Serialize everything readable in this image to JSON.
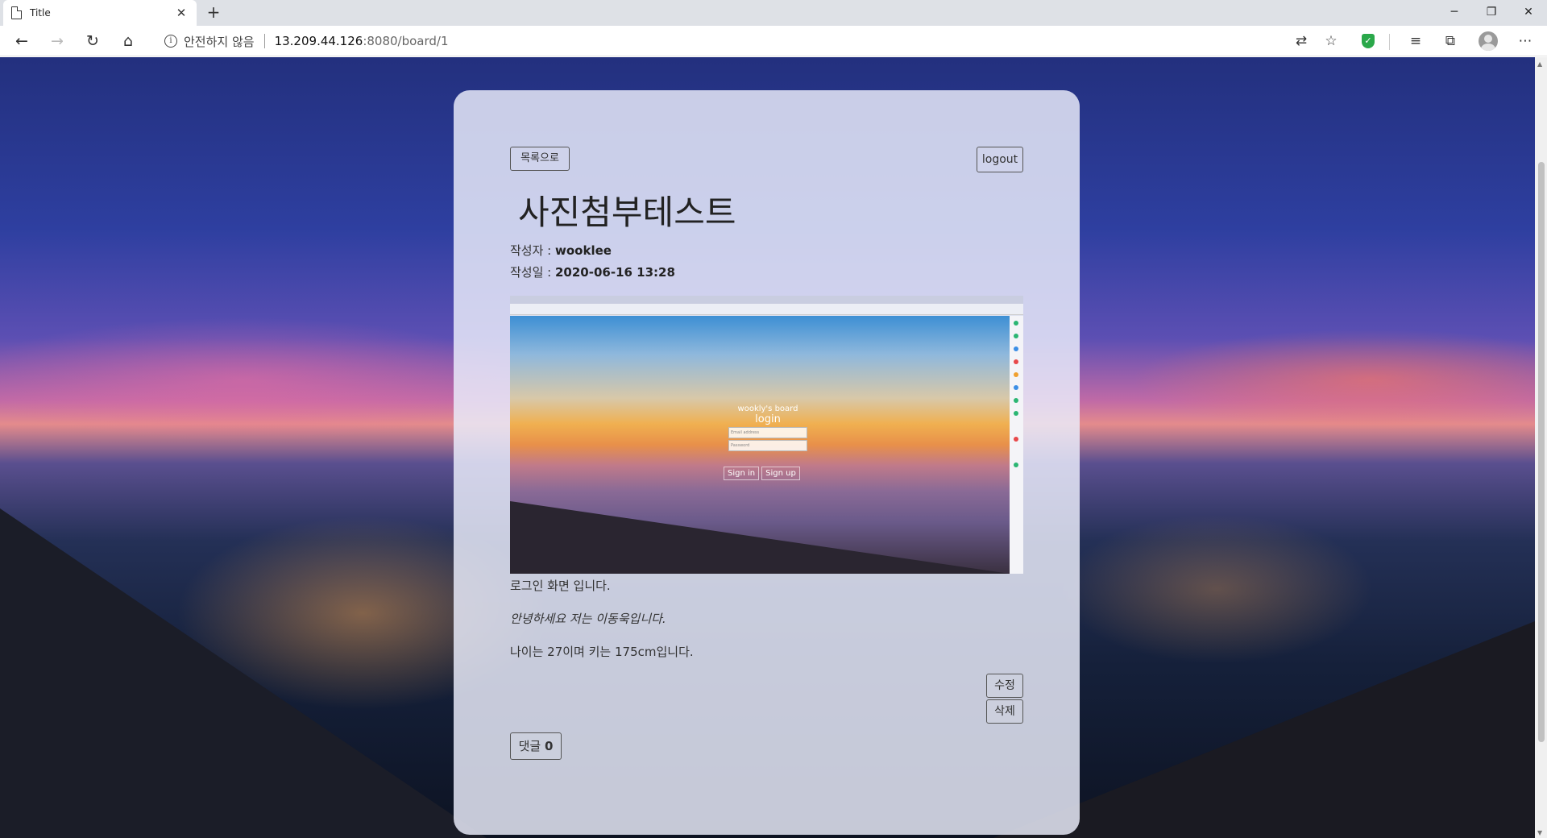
{
  "browser": {
    "tab_title": "Title",
    "address_insecure": "안전하지 않음",
    "address_host": "13.209.44.126",
    "address_rest": ":8080/board/1"
  },
  "page": {
    "back_label": "목록으로",
    "logout_label": "logout",
    "title": "사진첨부테스트",
    "author_label": "작성자 : ",
    "author": "wooklee",
    "date_label": "작성일 : ",
    "date": "2020-06-16 13:28",
    "content_lines": [
      "로그인 화면 입니다.",
      "안녕하세요 저는 이동욱입니다.",
      "나이는 27이며 키는 175cm입니다."
    ],
    "edit_label": "수정",
    "delete_label": "삭제",
    "comment_label": "댓글 ",
    "comment_count": "0"
  },
  "attachment": {
    "brand": "wookly's board",
    "heading": "login",
    "email_placeholder": "Email address",
    "password_placeholder": "Password",
    "signin_label": "Sign in",
    "signup_label": "Sign up"
  }
}
